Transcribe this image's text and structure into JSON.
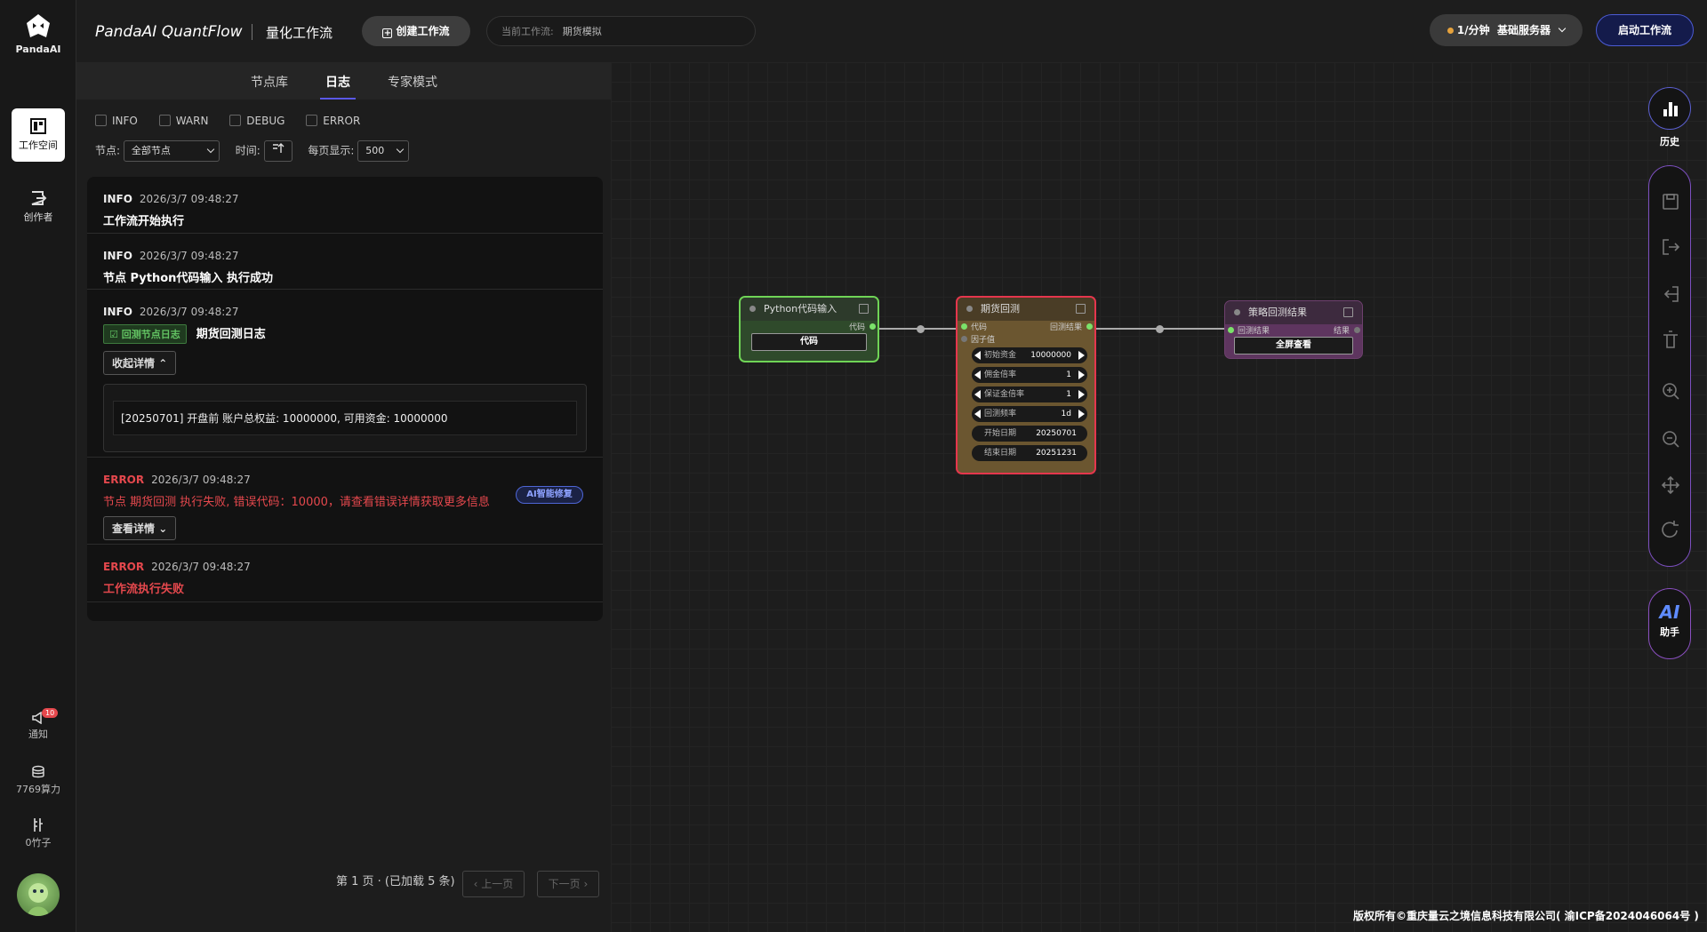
{
  "brand": {
    "logo_text": "PandaAI",
    "app_name": "PandaAI QuantFlow",
    "subtitle": "量化工作流"
  },
  "sidebar": {
    "items": [
      {
        "label": "工作空间",
        "icon": "workspace-icon",
        "active": true
      },
      {
        "label": "创作者",
        "icon": "creator-icon",
        "active": false
      }
    ],
    "notify": {
      "label": "通知",
      "badge": "10"
    },
    "compute": {
      "label": "7769算力"
    },
    "bamboo": {
      "label": "0竹子"
    }
  },
  "topbar": {
    "create_label": "创建工作流",
    "current_label": "当前工作流:",
    "current_value": "期货模拟",
    "server_rate": "1/分钟",
    "server_name": "基础服务器",
    "start_label": "启动工作流"
  },
  "panel": {
    "tabs": [
      {
        "label": "节点库"
      },
      {
        "label": "日志",
        "active": true
      },
      {
        "label": "专家模式"
      }
    ],
    "levels": [
      "INFO",
      "WARN",
      "DEBUG",
      "ERROR"
    ],
    "node_label": "节点:",
    "node_value": "全部节点",
    "time_label": "时间:",
    "page_size_label": "每页显示:",
    "page_size_value": "500",
    "logs": [
      {
        "level": "INFO",
        "time": "2026/3/7 09:48:27",
        "message": "工作流开始执行"
      },
      {
        "level": "INFO",
        "time": "2026/3/7 09:48:27",
        "message": "节点 Python代码输入 执行成功"
      },
      {
        "level": "INFO",
        "time": "2026/3/7 09:48:27",
        "tag": "回测节点日志",
        "message": "期货回测日志",
        "toggle": "收起详情",
        "detail": "[20250701] 开盘前 账户总权益: 10000000, 可用资金: 10000000"
      },
      {
        "level": "ERROR",
        "time": "2026/3/7 09:48:27",
        "message": "节点 期货回测 执行失败, 错误代码：10000，请查看错误详情获取更多信息",
        "ai_fix": "AI智能修复",
        "toggle": "查看详情"
      },
      {
        "level": "ERROR",
        "time": "2026/3/7 09:48:27",
        "message": "工作流执行失败"
      }
    ],
    "pager": {
      "text": "第 1 页 · (已加载 5 条)",
      "prev": "上一页",
      "next": "下一页"
    }
  },
  "nodes": {
    "python": {
      "title": "Python代码输入",
      "out_port": "代码",
      "button": "代码",
      "color": "#6fd456"
    },
    "backtest": {
      "title": "期货回测",
      "in_port": "代码",
      "out_port": "回测结果",
      "in_port2": "因子值",
      "color": "#e5364d",
      "params": [
        {
          "label": "初始资金",
          "value": "10000000"
        },
        {
          "label": "佣金倍率",
          "value": "1"
        },
        {
          "label": "保证金倍率",
          "value": "1"
        },
        {
          "label": "回测频率",
          "value": "1d"
        }
      ],
      "dates": [
        {
          "label": "开始日期",
          "value": "20250701"
        },
        {
          "label": "结束日期",
          "value": "20251231"
        }
      ]
    },
    "result": {
      "title": "策略回测结果",
      "in_port": "回测结果",
      "out_port": "结果",
      "button": "全屏查看",
      "color": "#8a4a8c"
    }
  },
  "right_tools": {
    "history_label": "历史",
    "ai_label": "AI",
    "ai_sub": "助手"
  },
  "footer": {
    "copyright": "版权所有©重庆量云之境信息科技有限公司( 渝ICP备2024046064号 )"
  }
}
